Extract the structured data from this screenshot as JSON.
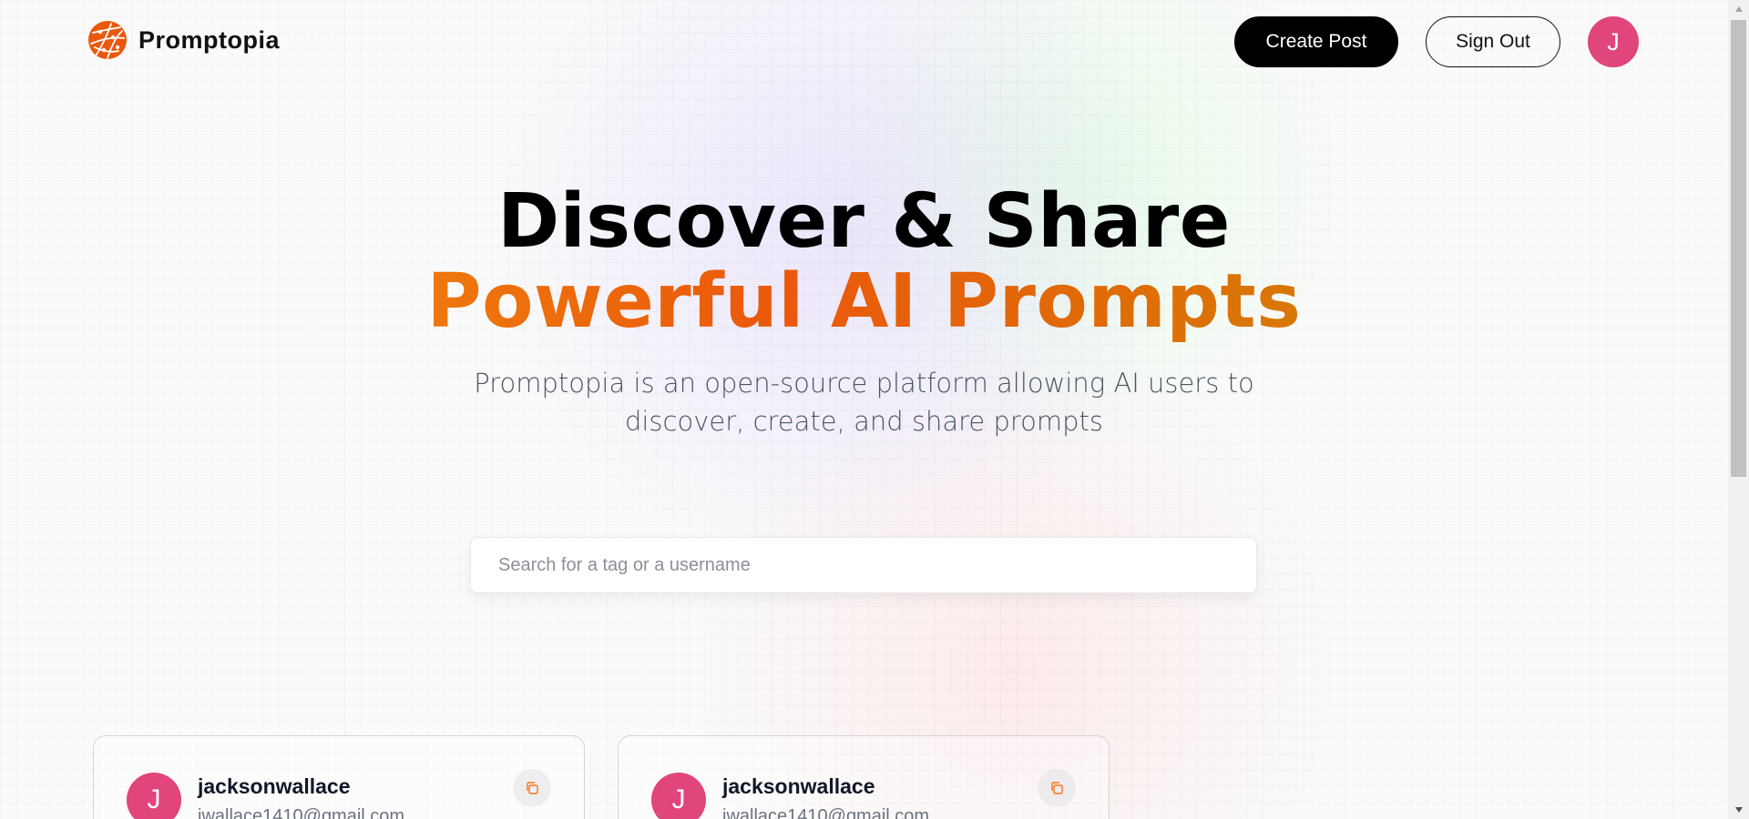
{
  "nav": {
    "brand_name": "Promptopia",
    "create_post_label": "Create Post",
    "sign_out_label": "Sign Out",
    "avatar_initial": "J"
  },
  "hero": {
    "title_line1": "Discover & Share",
    "title_line2": "Powerful AI Prompts",
    "description": "Promptopia is an open-source platform allowing AI users to discover, create, and share prompts"
  },
  "search": {
    "placeholder": "Search for a tag or a username",
    "value": ""
  },
  "cards": [
    {
      "avatar_initial": "J",
      "username": "jacksonwallace",
      "email": "jwallace1410@gmail.com"
    },
    {
      "avatar_initial": "J",
      "username": "jacksonwallace",
      "email": "jwallace1410@gmail.com"
    }
  ],
  "colors": {
    "avatar_bg": "#e0457b",
    "gradient_start": "#f59e0b",
    "gradient_mid": "#ea580c",
    "logo": "#ea580c"
  }
}
